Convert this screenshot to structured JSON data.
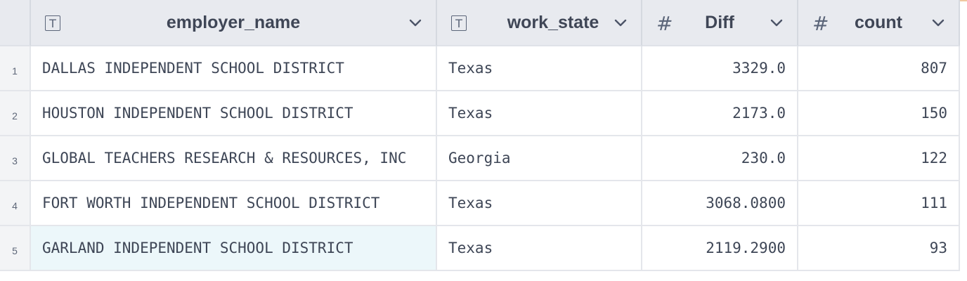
{
  "columns": [
    {
      "name": "employer_name",
      "type_icon": "text-type-icon",
      "type_glyph": "T"
    },
    {
      "name": "work_state",
      "type_icon": "text-type-icon",
      "type_glyph": "T"
    },
    {
      "name": "Diff",
      "type_icon": "number-type-icon",
      "type_glyph": "#"
    },
    {
      "name": "count",
      "type_icon": "number-type-icon",
      "type_glyph": "#"
    }
  ],
  "rows": [
    {
      "index": "1",
      "employer_name": "DALLAS INDEPENDENT SCHOOL DISTRICT",
      "work_state": "Texas",
      "diff": "3329.0",
      "count": "807"
    },
    {
      "index": "2",
      "employer_name": "HOUSTON INDEPENDENT SCHOOL DISTRICT",
      "work_state": "Texas",
      "diff": "2173.0",
      "count": "150"
    },
    {
      "index": "3",
      "employer_name": "GLOBAL TEACHERS RESEARCH & RESOURCES, INC",
      "work_state": "Georgia",
      "diff": "230.0",
      "count": "122"
    },
    {
      "index": "4",
      "employer_name": "FORT WORTH INDEPENDENT SCHOOL DISTRICT",
      "work_state": "Texas",
      "diff": "3068.0800",
      "count": "111"
    },
    {
      "index": "5",
      "employer_name": "GARLAND INDEPENDENT SCHOOL DISTRICT",
      "work_state": "Texas",
      "diff": "2119.2900",
      "count": "93"
    }
  ],
  "colors": {
    "header_bg": "#e8eaef",
    "selected_cell_bg": "#ecf7fa",
    "text": "#3e4656"
  }
}
